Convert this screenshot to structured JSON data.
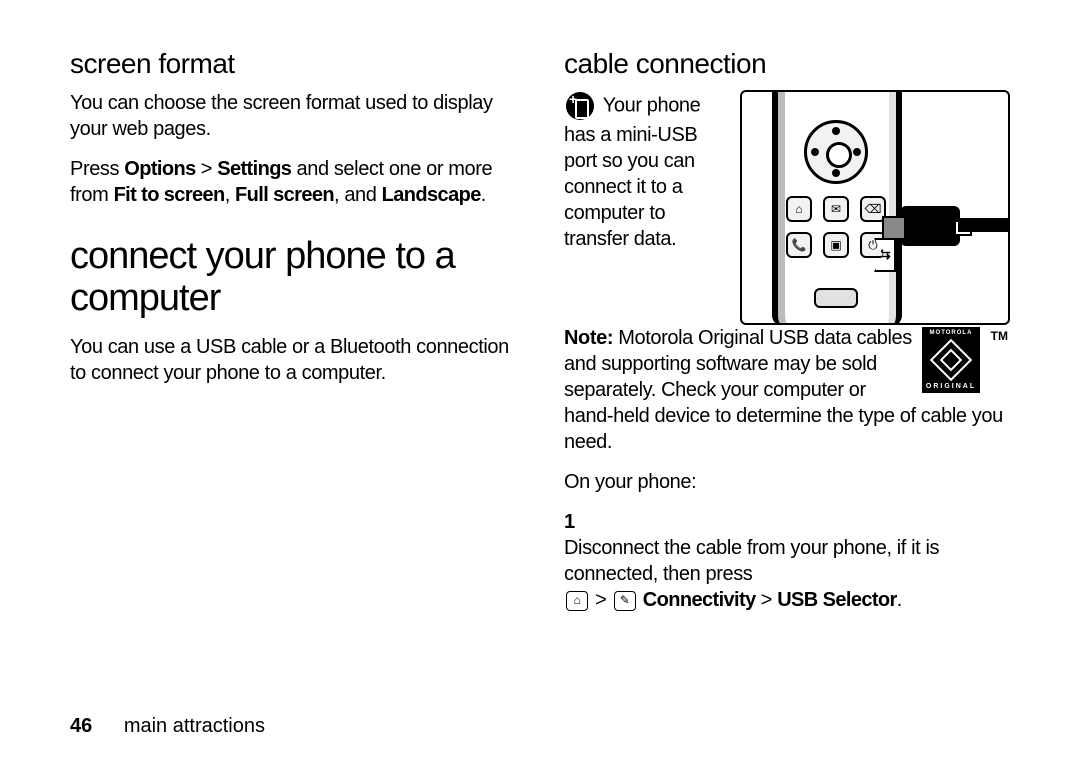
{
  "left": {
    "h_screen_format": "screen format",
    "p_screen_format": "You can choose the screen format used to display your web pages.",
    "press_prefix": "Press ",
    "options": "Options",
    "gt1": " > ",
    "settings": "Settings",
    "select_mid": " and select one or more from ",
    "fit": "Fit to screen",
    "comma1": ", ",
    "full": "Full screen",
    "comma2": ", and ",
    "landscape": "Landscape",
    "period": ".",
    "h_connect": "connect your phone to a computer",
    "p_connect": "You can use a USB cable or a Bluetooth connection to connect your phone to a computer."
  },
  "right": {
    "h_cable": "cable connection",
    "intro": "Your phone has a mini-USB port so you can connect it to a computer to transfer data.",
    "note_label": "Note: ",
    "note_body": "Motorola Original USB data cables and supporting software may be sold separately. Check your computer or hand-held device to determine the type of cable you need.",
    "on_phone": "On your phone:",
    "step1_num": "1",
    "step1_body": "Disconnect the cable from your phone, if it is connected, then press",
    "nav_gt": " > ",
    "nav_connectivity": "Connectivity",
    "nav_usb": "USB Selector",
    "nav_period": "."
  },
  "badge": {
    "top": "MOTOROLA",
    "bottom": "ORIGINAL"
  },
  "footer": {
    "page": "46",
    "section": "main attractions"
  },
  "icons": {
    "home": "⌂",
    "tools": "✎"
  }
}
